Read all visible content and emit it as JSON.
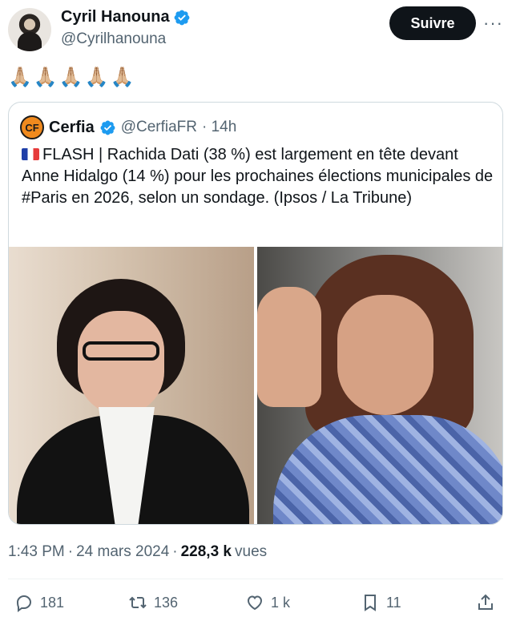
{
  "author": {
    "display_name": "Cyril Hanouna",
    "handle": "@Cyrilhanouna"
  },
  "follow_label": "Suivre",
  "more_label": "···",
  "tweet_text": "🙏🏼🙏🏼🙏🏼🙏🏼🙏🏼",
  "quoted": {
    "logo_text": "CF",
    "name": "Cerfia",
    "handle": "@CerfiaFR",
    "time": "· 14h",
    "text": "FLASH | Rachida Dati (38 %) est largement en tête devant Anne Hidalgo (14 %) pour les prochaines élections municipales de #Paris en 2026, selon un sondage. (Ipsos / La Tribune)"
  },
  "meta": {
    "time": "1:43 PM",
    "sep": "·",
    "date": "24 mars 2024",
    "sep2": "·",
    "views_count": "228,3 k",
    "views_label": "vues"
  },
  "actions": {
    "replies": "181",
    "reposts": "136",
    "likes": "1 k",
    "bookmarks": "11"
  },
  "colors": {
    "verified": "#1d9bf0",
    "text_primary": "#0f1419",
    "text_secondary": "#536471",
    "border": "#cfd9de"
  }
}
